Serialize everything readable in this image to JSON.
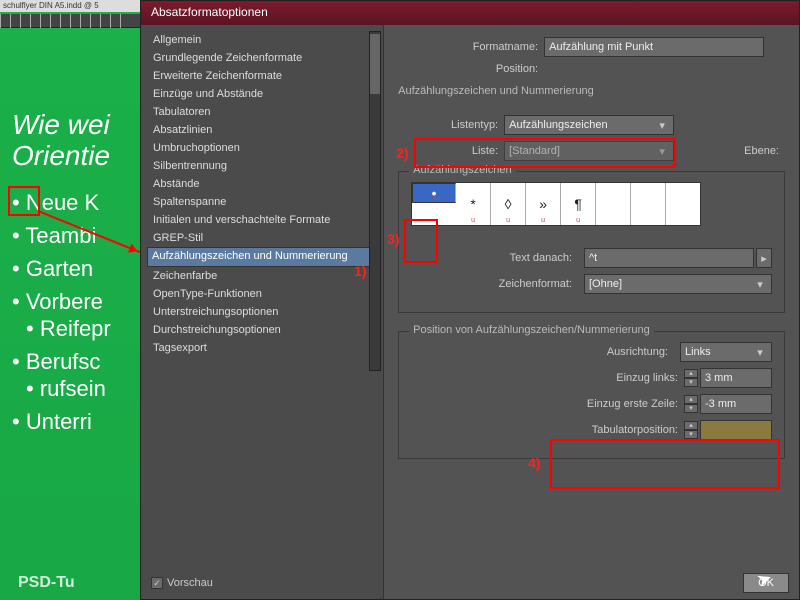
{
  "doc": {
    "tab": "schulflyer DIN A5.indd @ 5",
    "heading1": "Wie wei",
    "heading2": "Orientie",
    "bullets": [
      "Neue K",
      "Teambi",
      "Garten",
      "Vorbere",
      "Reifepr",
      "Berufsc",
      "rufsein",
      "Unterri"
    ],
    "brand": "PSD-Tu"
  },
  "dialog": {
    "title": "Absatzformatoptionen",
    "sidebar": [
      "Allgemein",
      "Grundlegende Zeichenformate",
      "Erweiterte Zeichenformate",
      "Einzüge und Abstände",
      "Tabulatoren",
      "Absatzlinien",
      "Umbruchoptionen",
      "Silbentrennung",
      "Abstände",
      "Spaltenspanne",
      "Initialen und verschachtelte Formate",
      "GREP-Stil",
      "Aufzählungszeichen und Nummerierung",
      "Zeichenfarbe",
      "OpenType-Funktionen",
      "Unterstreichungsoptionen",
      "Durchstreichungsoptionen",
      "Tagsexport"
    ],
    "sidebarSelectedIndex": 12,
    "formatname_label": "Formatname:",
    "formatname_value": "Aufzählung mit Punkt",
    "position_label": "Position:",
    "section_main": "Aufzählungszeichen und Nummerierung",
    "listentyp_label": "Listentyp:",
    "listentyp_value": "Aufzählungszeichen",
    "liste_label": "Liste:",
    "liste_value": "[Standard]",
    "ebene_label": "Ebene:",
    "bullets_legend": "Aufzählungszeichen",
    "bullets": [
      "•",
      "*",
      "◊",
      "»",
      "¶"
    ],
    "bulletSelectedIndex": 0,
    "text_danach_label": "Text danach:",
    "text_danach_value": "^t",
    "zeichenformat_label": "Zeichenformat:",
    "zeichenformat_value": "[Ohne]",
    "position_legend": "Position von Aufzählungszeichen/Nummerierung",
    "ausrichtung_label": "Ausrichtung:",
    "ausrichtung_value": "Links",
    "einzug_links_label": "Einzug links:",
    "einzug_links_value": "3 mm",
    "einzug_erste_label": "Einzug erste Zeile:",
    "einzug_erste_value": "-3 mm",
    "tabpos_label": "Tabulatorposition:",
    "tabpos_value": "",
    "vorschau": "Vorschau",
    "ok": "OK"
  },
  "annots": {
    "a1": "1)",
    "a2": "2)",
    "a3": "3)",
    "a4": "4)"
  }
}
